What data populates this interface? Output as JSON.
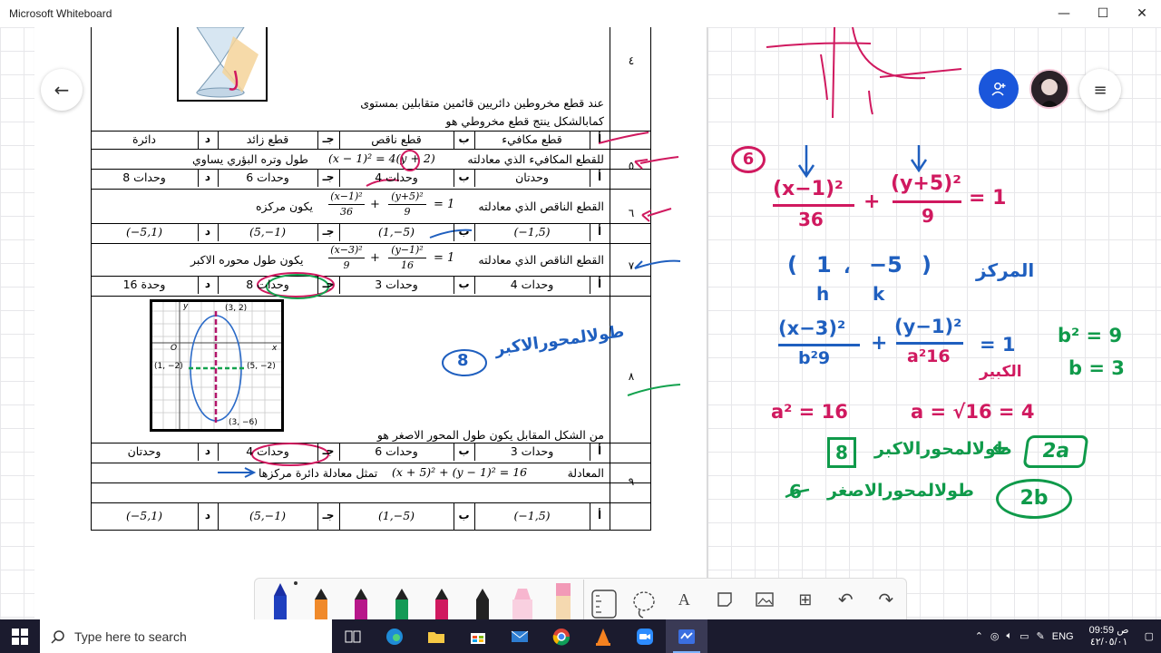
{
  "window": {
    "title": "Microsoft Whiteboard",
    "minimize": "—",
    "maximize": "☐",
    "close": "✕"
  },
  "exam": {
    "q4": {
      "num": "٤",
      "line1": "عند قطع مخروطين دائريين قائمين متقابلين بمستوى",
      "line2": "كمابالشكل ينتج قطع مخروطي هو",
      "options": [
        {
          "letter": "أ",
          "text": "قطع مكافيء"
        },
        {
          "letter": "ب",
          "text": "قطع ناقص"
        },
        {
          "letter": "جـ",
          "text": "قطع زائد"
        },
        {
          "letter": "د",
          "text": "دائرة"
        }
      ]
    },
    "q5": {
      "num": "٥",
      "text_pre": "للقطع المكافيء الذي معادلته",
      "equation": "(x − 1)² = 4(y + 2)",
      "text_post": "طول وتره البؤري يساوي",
      "options": [
        {
          "letter": "أ",
          "text": "وحدتان"
        },
        {
          "letter": "ب",
          "text": "4 وحدات"
        },
        {
          "letter": "جـ",
          "text": "6 وحدات"
        },
        {
          "letter": "د",
          "text": "8 وحدات"
        }
      ]
    },
    "q6": {
      "num": "٦",
      "text_pre": "القطع الناقص الذي معادلته",
      "frac1_num": "(x−1)²",
      "frac1_den": "36",
      "frac2_num": "(y+5)²",
      "frac2_den": "9",
      "eq_rhs": "= 1",
      "text_post": "يكون مركزه",
      "options": [
        {
          "letter": "أ",
          "text": "(−1,5)"
        },
        {
          "letter": "ب",
          "text": "(1,−5)"
        },
        {
          "letter": "جـ",
          "text": "(5,−1)"
        },
        {
          "letter": "د",
          "text": "(−5,1)"
        }
      ]
    },
    "q7": {
      "num": "٧",
      "text_pre": "القطع الناقص الذي معادلته",
      "frac1_num": "(x−3)²",
      "frac1_den": "9",
      "frac2_num": "(y−1)²",
      "frac2_den": "16",
      "eq_rhs": "= 1",
      "text_post": "يكون طول محوره الاكبر",
      "options": [
        {
          "letter": "أ",
          "text": "4 وحدات"
        },
        {
          "letter": "ب",
          "text": "3 وحدات"
        },
        {
          "letter": "جـ",
          "text": "8 وحدات"
        },
        {
          "letter": "د",
          "text": "16 وحدة"
        }
      ]
    },
    "q8": {
      "num": "٨",
      "text": "من الشكل المقابل يكون طول المحور الاصغر هو",
      "graph_labels": {
        "top": "(3, 2)",
        "left": "(1, −2)",
        "right": "(5, −2)",
        "bottom": "(3, −6)",
        "y": "y",
        "x": "x",
        "origin": "O"
      },
      "options": [
        {
          "letter": "أ",
          "text": "3 وحدات"
        },
        {
          "letter": "ب",
          "text": "6 وحدات"
        },
        {
          "letter": "جـ",
          "text": "4 وحدات"
        },
        {
          "letter": "د",
          "text": "وحدتان"
        }
      ]
    },
    "q9": {
      "num": "٩",
      "text_pre": "المعادلة",
      "equation": "(x + 5)² + (y − 1)² = 16",
      "text_post": "تمثل معادلة دائرة مركزها",
      "options": [
        {
          "letter": "أ",
          "text": "(−1,5)"
        },
        {
          "letter": "ب",
          "text": "(1,−5)"
        },
        {
          "letter": "جـ",
          "text": "(5,−1)"
        },
        {
          "letter": "د",
          "text": "(−5,1)"
        }
      ]
    }
  },
  "handwriting": {
    "page_note": "طولالمحورالاكبر",
    "page_circle": "8",
    "q_circle": "6",
    "eq1_num1": "(x−1)²",
    "eq1_den1": "36",
    "eq1_plus": "+",
    "eq1_num2": "(y+5)²",
    "eq1_den2": "9",
    "eq1_rhs": "= 1",
    "center_open": "(",
    "center_h": "1",
    "center_comma": "،",
    "center_k": "−5",
    "center_close": ")",
    "center_h_label": "h",
    "center_k_label": "k",
    "center_word": "المركز",
    "eq2_num1": "(x−3)²",
    "eq2_den1": "b²9",
    "eq2_plus": "+",
    "eq2_num2": "(y−1)²",
    "eq2_den2": "a²16",
    "eq2_rhs": "= 1",
    "big_word": "الكبير",
    "b_sq": "b² = 9",
    "b_val": "b = 3",
    "a_sq": "a² = 16",
    "a_val": "a = √16 = 4",
    "major_box": "8",
    "major_word": "طولالمحورالاكبر",
    "major_arrow": "←",
    "major_2a": "2a",
    "minor_word": "طولالمحورالاصغر",
    "minor_val": "6",
    "minor_2b": "2b"
  },
  "toolbar": {
    "tools": [
      "ballpoint-pen",
      "orange-pen",
      "purple-pen",
      "green-pen",
      "magenta-pen",
      "black-pen",
      "highlighter",
      "eraser",
      "ruler",
      "lasso",
      "text",
      "sticky-note",
      "image",
      "add",
      "undo",
      "redo"
    ],
    "text_tool_label": "A",
    "add_label": "⊞",
    "undo_label": "↶",
    "redo_label": "↷"
  },
  "taskbar": {
    "search_placeholder": "Type here to search",
    "lang": "ENG",
    "time": "09:59 ص",
    "date": "٤٢/٠٥/٠١"
  },
  "colors": {
    "ink_red": "#d0195f",
    "ink_blue": "#1f5fbf",
    "ink_green": "#0f9a4a",
    "accent_blue": "#1a56db"
  }
}
